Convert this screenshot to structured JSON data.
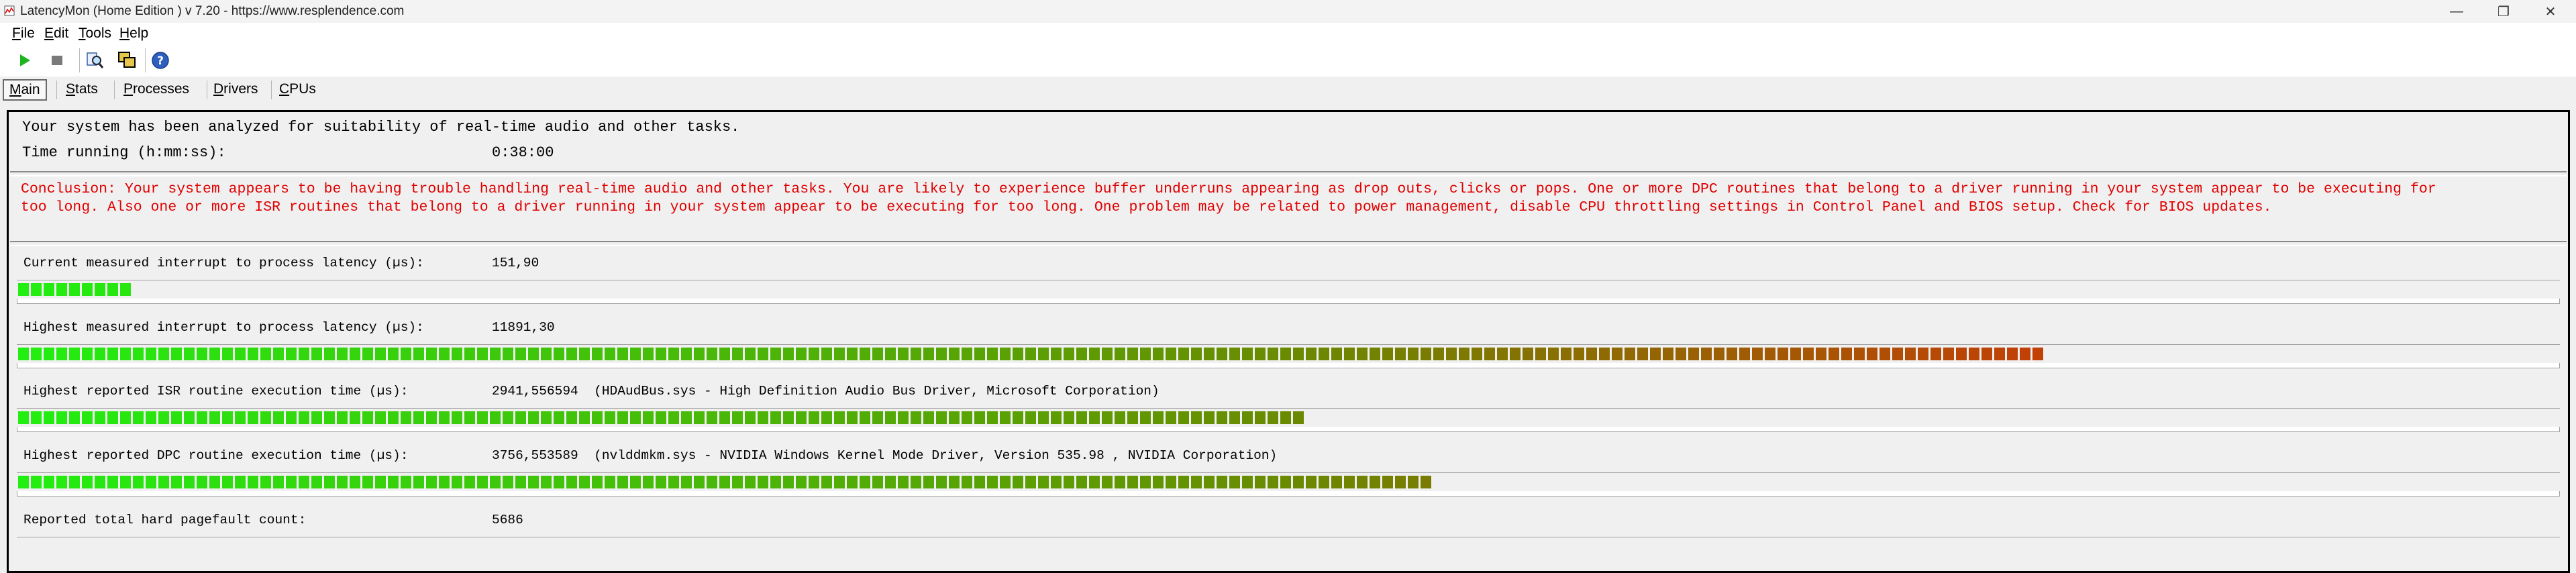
{
  "window": {
    "title": "LatencyMon  (Home Edition )  v 7.20 - https://www.resplendence.com",
    "minimize_glyph": "—",
    "maximize_glyph": "❐",
    "close_glyph": "✕"
  },
  "menu": {
    "file": {
      "accel": "F",
      "rest": "ile"
    },
    "edit": {
      "accel": "E",
      "rest": "dit"
    },
    "tools": {
      "accel": "T",
      "rest": "ools"
    },
    "help": {
      "accel": "H",
      "rest": "elp"
    }
  },
  "toolbar": {
    "icons": [
      "play-icon",
      "stop-icon",
      "find-icon",
      "windows-icon",
      "help-icon"
    ]
  },
  "tabs": [
    {
      "accel": "M",
      "rest": "ain",
      "active": true
    },
    {
      "accel": "S",
      "rest": "tats",
      "active": false
    },
    {
      "accel": "P",
      "rest": "rocesses",
      "active": false
    },
    {
      "accel": "D",
      "rest": "rivers",
      "active": false
    },
    {
      "accel": "C",
      "rest": "PUs",
      "active": false
    }
  ],
  "main": {
    "analyzed_text": "Your system has been analyzed for suitability of real-time audio and other tasks.",
    "time_label": "Time running (h:mm:ss):",
    "time_value": "0:38:00",
    "conclusion": "Conclusion: Your system appears to be having trouble handling real-time audio and other tasks. You are likely to experience buffer underruns appearing as drop outs, clicks or pops. One or more DPC routines that belong to a driver running in your system appear to be executing for\ntoo long. Also one or more ISR routines that belong to a driver running in your system appear to be executing for too long. One problem may be related to power management, disable CPU throttling settings in Control Panel and BIOS setup. Check for BIOS updates."
  },
  "metrics": [
    {
      "label": "Current measured interrupt to process latency (µs):",
      "value": "151,90",
      "detail": "",
      "bar_fraction": 0.0436
    },
    {
      "label": "Highest measured interrupt to process latency (µs):",
      "value": "11891,30",
      "detail": "",
      "bar_fraction": 0.8
    },
    {
      "label": "Highest reported ISR routine execution time (µs):",
      "value": "2941,556594",
      "detail": "(HDAudBus.sys - High Definition Audio Bus Driver, Microsoft Corporation)",
      "bar_fraction": 0.51
    },
    {
      "label": "Highest reported DPC routine execution time (µs):",
      "value": "3756,553589",
      "detail": "(nvlddmkm.sys - NVIDIA Windows Kernel Mode Driver, Version 535.98 , NVIDIA Corporation)",
      "bar_fraction": 0.56
    },
    {
      "label": "Reported total hard pagefault count:",
      "value": "5686",
      "detail": "",
      "bar_fraction": null
    }
  ],
  "colors": {
    "bar_start": "#22ee11",
    "bar_mid": "#6a8a00",
    "bar_end": "#ff0a0a",
    "conclusion_text": "#e00000"
  }
}
